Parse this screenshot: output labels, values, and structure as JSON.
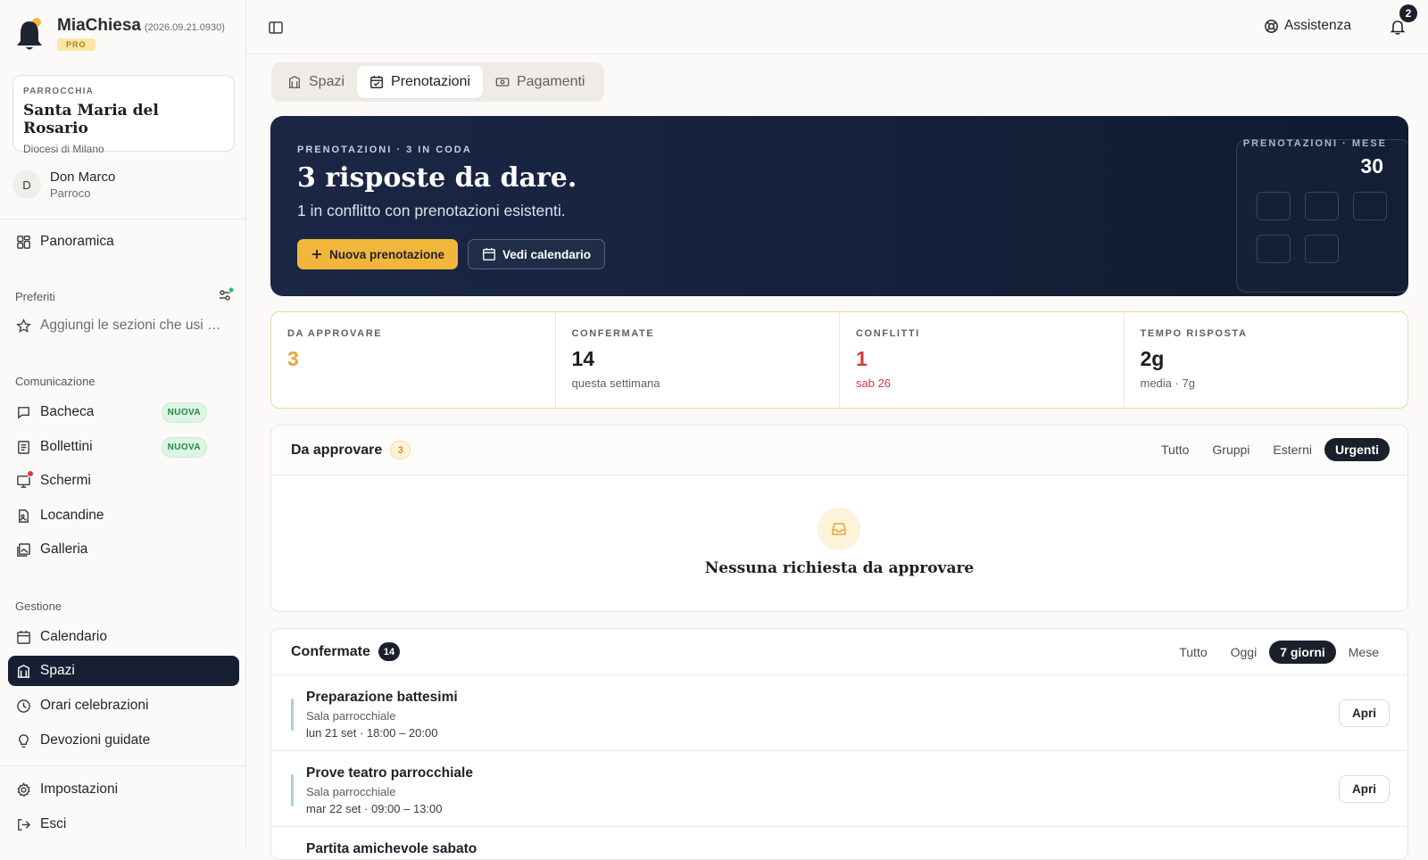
{
  "brand": {
    "name": "MiaChiesa",
    "version": "(2026.09.21.0930)",
    "plan": "PRO"
  },
  "parish": {
    "kicker": "PARROCCHIA",
    "name": "Santa Maria del Rosario",
    "diocese": "Diocesi di Milano"
  },
  "user": {
    "initial": "D",
    "name": "Don Marco",
    "role": "Parroco"
  },
  "nav": {
    "overview": "Panoramica",
    "favorites_label": "Preferiti",
    "favorites_hint": "Aggiungi le sezioni che usi …",
    "communication_label": "Comunicazione",
    "communication": [
      {
        "label": "Bacheca",
        "badge": "NUOVA"
      },
      {
        "label": "Bollettini",
        "badge": "NUOVA"
      },
      {
        "label": "Schermi"
      },
      {
        "label": "Locandine"
      },
      {
        "label": "Galleria"
      }
    ],
    "management_label": "Gestione",
    "management": [
      {
        "label": "Calendario"
      },
      {
        "label": "Spazi"
      },
      {
        "label": "Orari celebrazioni"
      },
      {
        "label": "Devozioni guidate"
      }
    ],
    "settings": "Impostazioni",
    "logout": "Esci"
  },
  "topbar": {
    "help": "Assistenza",
    "notifications": "2"
  },
  "tabs": [
    {
      "label": "Spazi",
      "icon": "building-icon"
    },
    {
      "label": "Prenotazioni",
      "icon": "calendar-check-icon"
    },
    {
      "label": "Pagamenti",
      "icon": "cash-icon"
    }
  ],
  "hero": {
    "kicker": "PRENOTAZIONI · 3 IN CODA",
    "title": "3 risposte da dare.",
    "subtitle": "1 in conflitto con prenotazioni esistenti.",
    "primary": "Nuova prenotazione",
    "secondary": "Vedi calendario",
    "month_label": "PRENOTAZIONI · MESE",
    "month_value": "30"
  },
  "stats": [
    {
      "key": "DA APPROVARE",
      "value": "3",
      "detail": "",
      "color": "#e1a93a"
    },
    {
      "key": "CONFERMATE",
      "value": "14",
      "detail": "questa settimana",
      "color": "#1b1d24"
    },
    {
      "key": "CONFLITTI",
      "value": "1",
      "detail": "sab 26",
      "color": "#d23c3c"
    },
    {
      "key": "TEMPO RISPOSTA",
      "value": "2g",
      "detail": "media · 7g",
      "color": "#1b1d24"
    }
  ],
  "pending": {
    "title": "Da approvare",
    "count": "3",
    "filters": [
      "Tutto",
      "Gruppi",
      "Esterni",
      "Urgenti"
    ],
    "active_filter": "Urgenti",
    "empty": "Nessuna richiesta da approvare"
  },
  "confirmed": {
    "title": "Confermate",
    "count": "14",
    "filters": [
      "Tutto",
      "Oggi",
      "7 giorni",
      "Mese"
    ],
    "active_filter": "7 giorni",
    "open_label": "Apri",
    "items": [
      {
        "title": "Preparazione battesimi",
        "place": "Sala parrocchiale",
        "when": "lun 21 set · 18:00 – 20:00"
      },
      {
        "title": "Prove teatro parrocchiale",
        "place": "Sala parrocchiale",
        "when": "mar 22 set · 09:00 – 13:00"
      },
      {
        "title": "Partita amichevole sabato",
        "place": "",
        "when": ""
      }
    ]
  }
}
